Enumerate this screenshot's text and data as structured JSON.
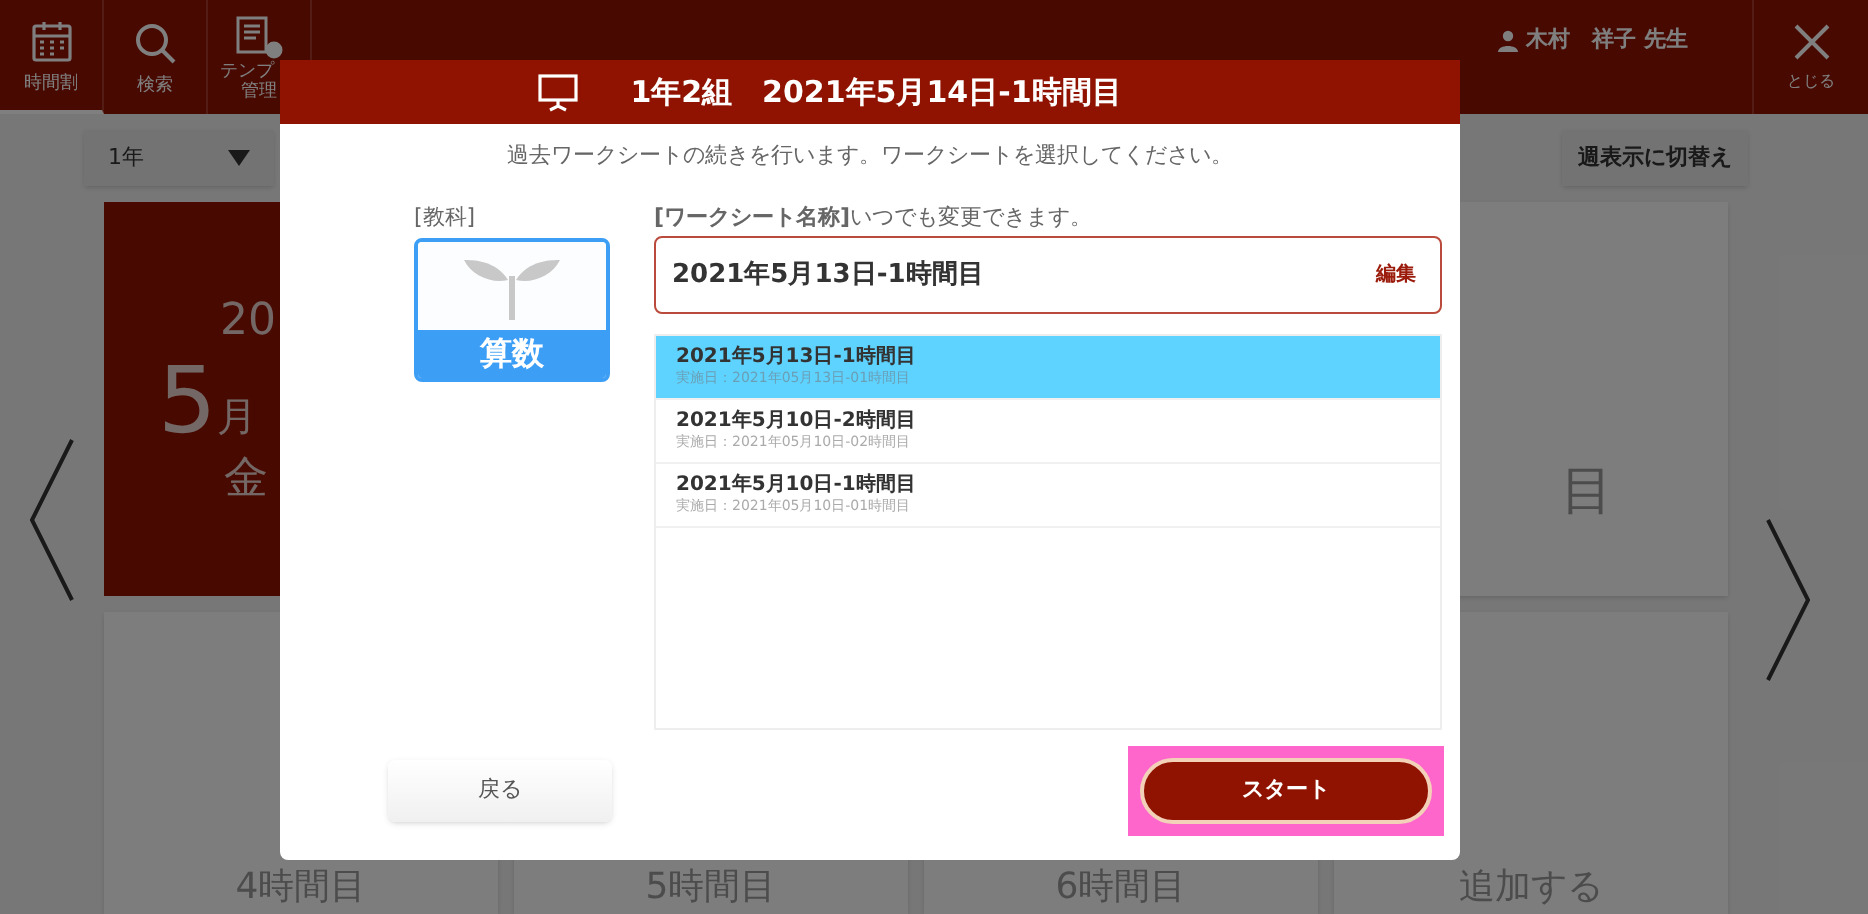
{
  "header": {
    "nav": [
      {
        "label": "時間割",
        "selected": true
      },
      {
        "label": "検索",
        "selected": false
      },
      {
        "label": "テンプ",
        "label_2": "管理",
        "selected": false
      }
    ],
    "user": "木村　祥子 先生",
    "close_label": "とじる"
  },
  "toolbar": {
    "grade": "1年",
    "view_toggle": "週表示に切替え"
  },
  "date_card": {
    "year": "20",
    "month": "5",
    "month_unit": "月",
    "weekday": "金"
  },
  "period_cards": [
    {
      "label": "目"
    }
  ],
  "bottom_cards": [
    {
      "label": "4時間目"
    },
    {
      "label": "5時間目"
    },
    {
      "label": "6時間目"
    },
    {
      "label": "追加する"
    }
  ],
  "dialog": {
    "title": "1年2組　2021年5月14日-1時間目",
    "message": "過去ワークシートの続きを行います。ワークシートを選択してください。",
    "subject_label": "[教科]",
    "subject": "算数",
    "name_label": "[ワークシート名称]",
    "name_hint": "いつでも変更できます。",
    "name_value": "2021年5月13日-1時間目",
    "edit_label": "編集",
    "worksheets": [
      {
        "title": "2021年5月13日-1時間目",
        "date": "実施日：2021年05月13日-01時間目",
        "selected": true
      },
      {
        "title": "2021年5月10日-2時間目",
        "date": "実施日：2021年05月10日-02時間目",
        "selected": false
      },
      {
        "title": "2021年5月10日-1時間目",
        "date": "実施日：2021年05月10日-01時間目",
        "selected": false
      }
    ],
    "back_button": "戻る",
    "start_button": "スタート",
    "start_highlighted": true
  }
}
